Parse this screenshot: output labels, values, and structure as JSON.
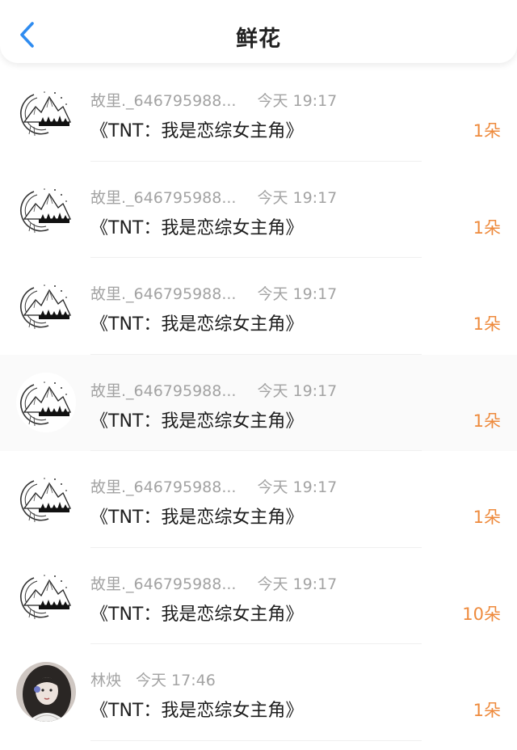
{
  "header": {
    "title": "鲜花",
    "back_icon": "chevron-left-icon",
    "accent_color": "#2f8cf0"
  },
  "colors": {
    "count": "#ee8a3c",
    "meta": "#a3a3a3"
  },
  "rows": [
    {
      "name": "故里._646795988...",
      "time": "今天 19:17",
      "book": "《TNT：我是恋综女主角》",
      "count": "1朵",
      "avatar": "mountain-sketch-avatar"
    },
    {
      "name": "故里._646795988...",
      "time": "今天 19:17",
      "book": "《TNT：我是恋综女主角》",
      "count": "1朵",
      "avatar": "mountain-sketch-avatar"
    },
    {
      "name": "故里._646795988...",
      "time": "今天 19:17",
      "book": "《TNT：我是恋综女主角》",
      "count": "1朵",
      "avatar": "mountain-sketch-avatar"
    },
    {
      "name": "故里._646795988...",
      "time": "今天 19:17",
      "book": "《TNT：我是恋综女主角》",
      "count": "1朵",
      "avatar": "mountain-sketch-avatar"
    },
    {
      "name": "故里._646795988...",
      "time": "今天 19:17",
      "book": "《TNT：我是恋综女主角》",
      "count": "1朵",
      "avatar": "mountain-sketch-avatar"
    },
    {
      "name": "故里._646795988...",
      "time": "今天 19:17",
      "book": "《TNT：我是恋综女主角》",
      "count": "10朵",
      "avatar": "mountain-sketch-avatar"
    },
    {
      "name": "林炴",
      "time": "今天 17:46",
      "book": "《TNT：我是恋综女主角》",
      "count": "1朵",
      "avatar": "girl-photo-avatar"
    }
  ]
}
